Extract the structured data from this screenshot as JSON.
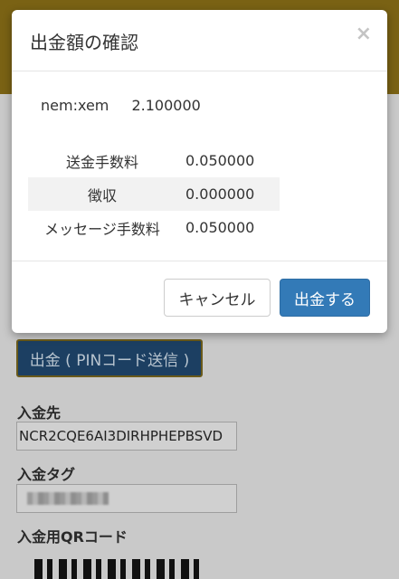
{
  "background": {
    "withdraw_button_label": "出金 ( PINコード送信 )",
    "deposit_to_label": "入金先",
    "deposit_to_value": "NCR2CQE6AI3DIRHPHEPBSVD",
    "deposit_tag_label": "入金タグ",
    "qr_label": "入金用QRコード"
  },
  "modal": {
    "title": "出金額の確認",
    "close_glyph": "×",
    "currency": "nem:xem",
    "amount": "2.100000",
    "fees": [
      {
        "label": "送金手数料",
        "value": "0.050000"
      },
      {
        "label": "徴収",
        "value": "0.000000"
      },
      {
        "label": "メッセージ手数料",
        "value": "0.050000"
      }
    ],
    "cancel_label": "キャンセル",
    "confirm_label": "出金する"
  },
  "colors": {
    "primary": "#337ab7",
    "header_bg": "#7a6214"
  }
}
